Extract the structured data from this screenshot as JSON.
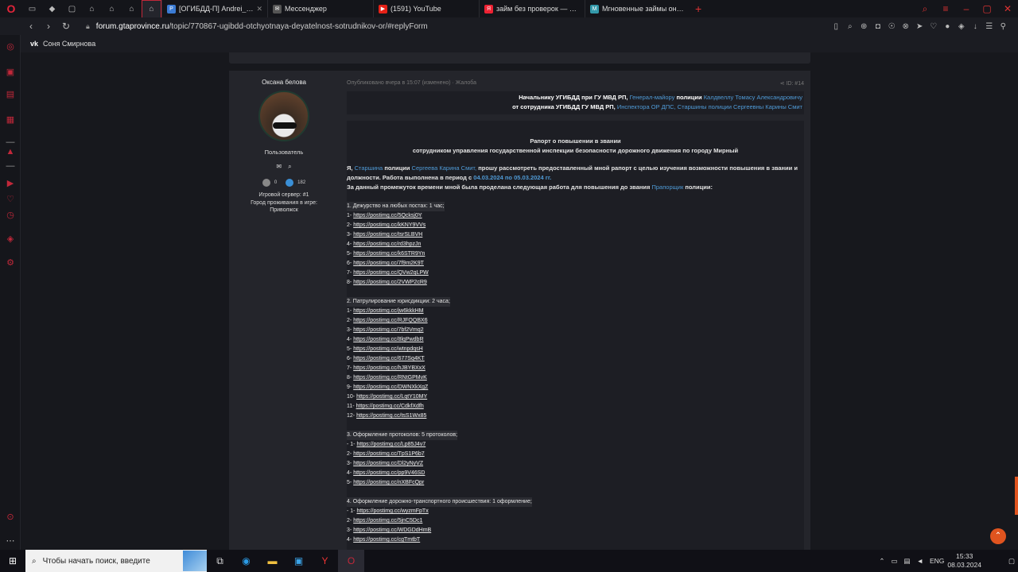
{
  "tabs": [
    {
      "label": "[ОГИБДД-П] Andrei_Romanov",
      "icon_color": "#3b7bd4"
    },
    {
      "label": "Мессенджер",
      "icon_color": "#555"
    },
    {
      "label": "(1591) YouTube",
      "icon_color": "#e62117"
    },
    {
      "label": "займ без проверок — Яндекс",
      "icon_color": "#e23"
    },
    {
      "label": "Мгновенные займы онлайн",
      "icon_color": "#39a"
    }
  ],
  "address": {
    "domain": "forum.gtaprovince.ru",
    "path": "/topic/770867-ugibdd-otchyotnaya-deyatelnost-sotrudnikov-or/#replyForm"
  },
  "bookmark": {
    "label": "Соня Смирнова"
  },
  "author": {
    "name": "Оксана белова",
    "role": "Пользователь",
    "reactions": "0",
    "posts": "182",
    "server": "Игровой сервер: #1",
    "city_label": "Город проживания в игре:",
    "city": "Приволжск"
  },
  "post": {
    "meta": "Опубликовано вчера в 15:07 (изменено) · Жалоба",
    "post_id": "ID: #14",
    "header_line1_a": "Начальнику УГИБДД при ГУ МВД РП,",
    "header_line1_b": "Генерал-майору",
    "header_line1_c": "полиции",
    "header_line1_d": "Калдвеллу Томасу Александровичу",
    "header_line2_a": "от сотрудника УГИБДД ГУ МВД РП,",
    "header_line2_b": "Инспектора ОР ДПС, Старшины полиции Сергеевны  Карины Смит",
    "title1": "Рапорт о повышении в звании",
    "title2": "сотрудником управления государственной инспекции безопасности дорожного движения по городу Мирный",
    "intro_a": "Я,",
    "intro_b": "Старшина",
    "intro_c": "полиции",
    "intro_d": "Сергеева Карина Смит,",
    "intro_e": "прошу рассмотреть предоставленный мной рапорт с целью изучения возможности повышения в звании и",
    "intro_f": "должности. Работа выполнена в период с",
    "intro_g": "04.03.2024 по 05.03.2024 гг.",
    "intro_h": "За данный промежуток времени мной была проделана следующая работа для повышения до звания",
    "intro_i": "Прапорщик",
    "intro_j": "полиции:",
    "sections": [
      {
        "title": "1. Дежурство на любых постах: 1 час;",
        "items": [
          {
            "n": " 1-",
            "url": "https://postimg.cc/5Qcksj0Y"
          },
          {
            "n": "2-",
            "url": "https://postimg.cc/kKNY9VVs"
          },
          {
            "n": " 3-",
            "url": "https://postimg.cc/tsrSLBVH"
          },
          {
            "n": " 4-",
            "url": "https://postimg.cc/rd3hpzJn"
          },
          {
            "n": " 5-",
            "url": "https://postimg.cc/k6STR9Yn"
          },
          {
            "n": " 6-",
            "url": "https://postimg.cc/7f9m2K9T"
          },
          {
            "n": "7-",
            "url": "https://postimg.cc/QVw2qLPW"
          },
          {
            "n": "8-",
            "url": "https://postimg.cc/2VWP2cR9"
          }
        ]
      },
      {
        "title": "2. Патрулирование юрисдикции: 2 часа;",
        "items": [
          {
            "n": "1-",
            "url": "https://postimg.cc/jw6kkkHM"
          },
          {
            "n": " 2-",
            "url": "https://postimg.cc/RJFQQBX6"
          },
          {
            "n": " 3-",
            "url": "https://postimg.cc/7bf2Vmq2"
          },
          {
            "n": " 4-",
            "url": "https://postimg.cc/8lqPwdbR"
          },
          {
            "n": " 5-",
            "url": "https://postimg.cc/wtnpdqsH"
          },
          {
            "n": "6-",
            "url": "https://postimg.cc/677Sq4KT"
          },
          {
            "n": " 7-",
            "url": "https://postimg.cc/hJBYBXxX"
          },
          {
            "n": "8-",
            "url": "https://postimg.cc/RNtGPMvK"
          },
          {
            "n": "9-",
            "url": "https://postimg.cc/DWNXkXgZ"
          },
          {
            "n": "10-",
            "url": "https://postimg.cc/LqtY10MY"
          },
          {
            "n": " 11-",
            "url": "https://postimg.cc/CdkfXdfh"
          },
          {
            "n": " 12-",
            "url": "https://postimg.cc/tsS1Wx85"
          }
        ]
      },
      {
        "title": "3. Оформление протоколов: 5 протоколов;",
        "items": [
          {
            "n": "- 1-",
            "url": "https://postimg.cc/Lp85J4v7"
          },
          {
            "n": " 2-",
            "url": "https://postimg.cc/TpS1P6b7"
          },
          {
            "n": " 3-",
            "url": "https://postimg.cc/Dl2yNyVZ"
          },
          {
            "n": "4-",
            "url": "https://postimg.cc/pp9V46SD"
          },
          {
            "n": "5-",
            "url": "https://postimg.cc/nXBFcQpr"
          }
        ]
      },
      {
        "title": "4. Оформление дорожно-транспортного происшествия: 1 оформление;",
        "items": [
          {
            "n": "- 1-",
            "url": "https://postimg.cc/wyzmFpTx"
          },
          {
            "n": " 2-",
            "url": "https://postimg.cc/5jnC5Dc1"
          },
          {
            "n": " 3-",
            "url": "https://postimg.cc/WDGDdHmB"
          },
          {
            "n": " 4-",
            "url": "https://postimg.cc/cgTmtbT"
          }
        ]
      }
    ]
  },
  "taskbar": {
    "search_placeholder": "Чтобы начать поиск, введите",
    "lang": "ENG",
    "time": "15:33",
    "date": "08.03.2024"
  },
  "colors": {
    "accent": "#c2283a",
    "link_blue": "#4f9ad6",
    "scroll_btn": "#e0541f"
  }
}
